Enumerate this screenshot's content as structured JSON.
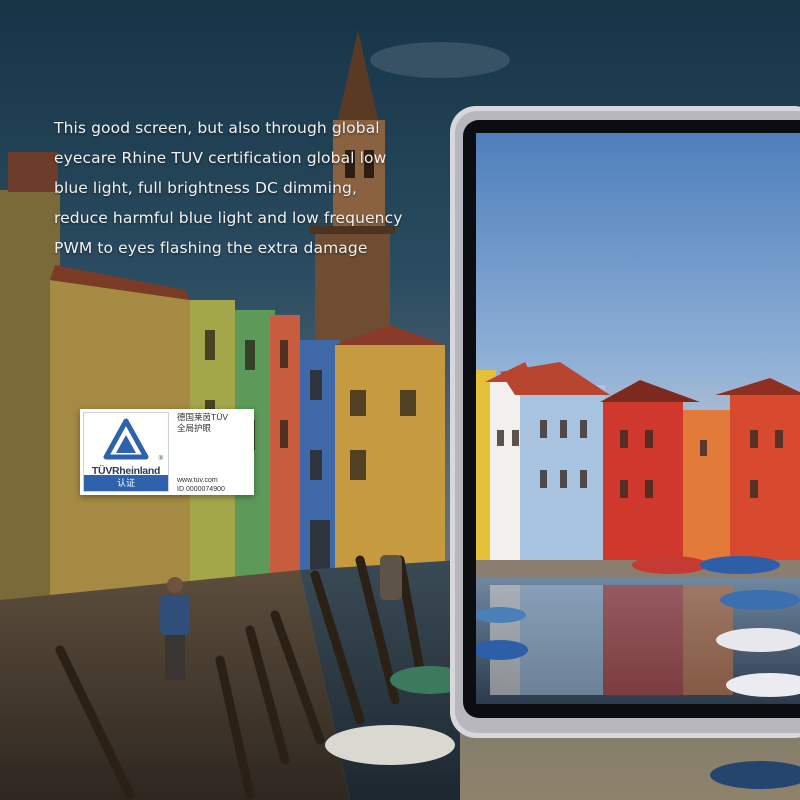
{
  "headline": {
    "lines": [
      "This good screen, but also through global",
      "eyecare Rhine TUV certification global low",
      "blue light, full brightness DC dimming,",
      "reduce harmful blue light and low frequency",
      "PWM to eyes flashing the extra damage"
    ]
  },
  "badge": {
    "brand": "TÜVRheinland",
    "registered_mark": "®",
    "cert_label": "认证",
    "title_line1": "德国莱茵TÜV",
    "title_line2": "全局护眼",
    "url": "www.tuv.com",
    "id": "ID  0000074900"
  },
  "colors": {
    "sky_top": "#163446",
    "tablet_frame": "#d8d8dc",
    "tuv_blue": "#2e62ad"
  }
}
